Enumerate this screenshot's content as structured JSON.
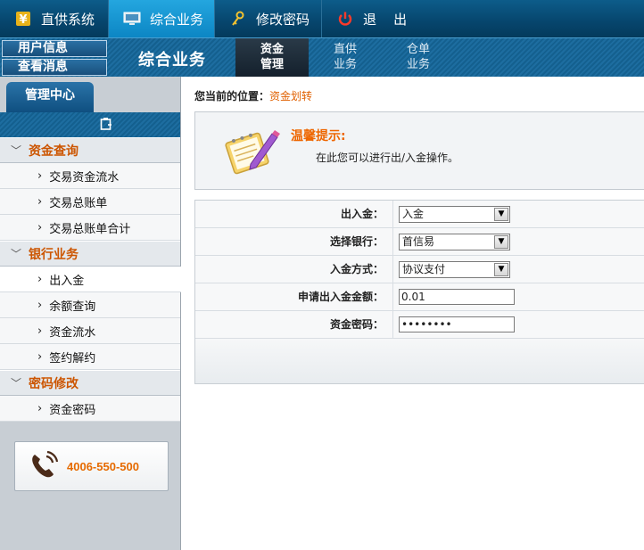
{
  "topnav": {
    "items": [
      {
        "label": "直供系统",
        "icon": "yuan-icon"
      },
      {
        "label": "综合业务",
        "icon": "monitor-icon"
      },
      {
        "label": "修改密码",
        "icon": "key-icon"
      },
      {
        "label": "退    出",
        "icon": "power-icon"
      }
    ]
  },
  "subheader": {
    "user_info": "用户信息",
    "view_messages": "查看消息",
    "title": "综合业务",
    "tabs": [
      {
        "line1": "资金",
        "line2": "管理"
      },
      {
        "line1": "直供",
        "line2": "业务"
      },
      {
        "line1": "仓单",
        "line2": "业务"
      }
    ]
  },
  "sidebar": {
    "tab": "管理中心",
    "groups": [
      {
        "label": "资金查询",
        "items": [
          "交易资金流水",
          "交易总账单",
          "交易总账单合计"
        ]
      },
      {
        "label": "银行业务",
        "items": [
          "出入金",
          "余额查询",
          "资金流水",
          "签约解约"
        ]
      },
      {
        "label": "密码修改",
        "items": [
          "资金密码"
        ]
      }
    ],
    "phone": "4006-550-500"
  },
  "main": {
    "breadcrumb_label": "您当前的位置：",
    "breadcrumb_current": "资金划转",
    "tip_title": "温馨提示:",
    "tip_text": "在此您可以进行出/入金操作。",
    "form": {
      "rows": [
        {
          "label": "出入金：",
          "type": "select",
          "value": "入金"
        },
        {
          "label": "选择银行：",
          "type": "select",
          "value": "首信易"
        },
        {
          "label": "入金方式：",
          "type": "select",
          "value": "协议支付"
        },
        {
          "label": "申请出入金金额：",
          "type": "text",
          "value": "0.01"
        },
        {
          "label": "资金密码：",
          "type": "password",
          "value": "••••••••"
        }
      ]
    }
  },
  "colors": {
    "nav_bg": "#06456c",
    "nav_active": "#1598d4",
    "accent_orange": "#e66a00",
    "sidebar_bg": "#c8ced4"
  }
}
